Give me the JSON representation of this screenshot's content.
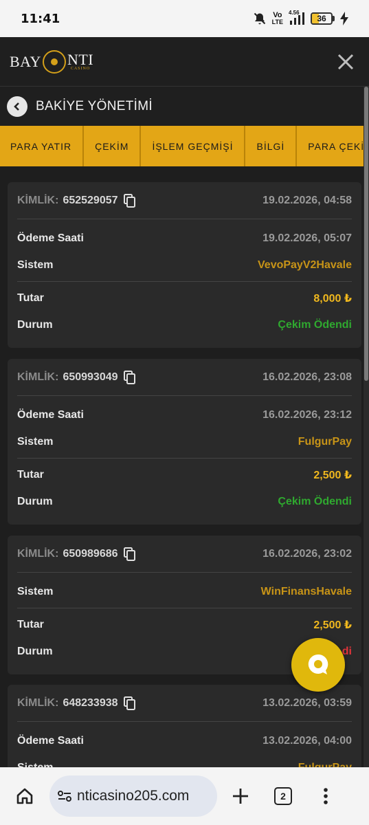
{
  "status_bar": {
    "time": "11:41",
    "network_label_top": "Vo",
    "network_label_bottom": "LTE",
    "speed": "4.56",
    "battery": "36",
    "battery_level_percent": 36
  },
  "header": {
    "logo_left": "BAY",
    "logo_right": "NTI",
    "logo_sub": "CASINO"
  },
  "page": {
    "title": "BAKİYE YÖNETİMİ"
  },
  "tabs": [
    {
      "label": "PARA YATIR"
    },
    {
      "label": "ÇEKİM"
    },
    {
      "label": "İŞLEM GEÇMİŞİ"
    },
    {
      "label": "BİLGİ"
    },
    {
      "label": "PARA ÇEKİM"
    }
  ],
  "labels": {
    "id": "KİMLİK:",
    "payment_time": "Ödeme Saati",
    "system": "Sistem",
    "amount": "Tutar",
    "status": "Durum"
  },
  "transactions": [
    {
      "id": "652529057",
      "date": "19.02.2026, 04:58",
      "payment_time": "19.02.2026, 05:07",
      "system": "VevoPayV2Havale",
      "amount": "8,000 ₺",
      "status": "Çekim Ödendi",
      "status_color": "#2fa92f"
    },
    {
      "id": "650993049",
      "date": "16.02.2026, 23:08",
      "payment_time": "16.02.2026, 23:12",
      "system": "FulgurPay",
      "amount": "2,500 ₺",
      "status": "Çekim Ödendi",
      "status_color": "#2fa92f"
    },
    {
      "id": "650989686",
      "date": "16.02.2026, 23:02",
      "system": "WinFinansHavale",
      "amount": "2,500 ₺",
      "status": "di",
      "status_color": "#e2343a"
    },
    {
      "id": "648233938",
      "date": "13.02.2026, 03:59",
      "payment_time": "13.02.2026, 04:00",
      "system": "FulgurPay"
    }
  ],
  "browser": {
    "url": "nticasino205.com",
    "tab_count": "2"
  },
  "colors": {
    "accent": "#e3a616",
    "gold_text": "#c89417",
    "amount": "#f0b81e",
    "success": "#2fa92f",
    "danger": "#e2343a"
  }
}
